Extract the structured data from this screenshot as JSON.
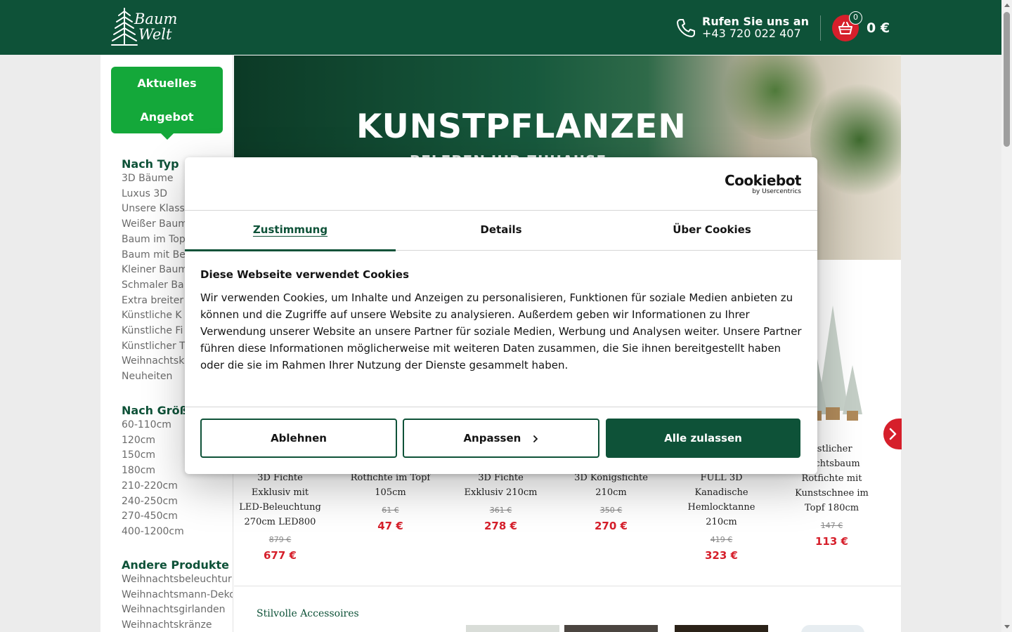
{
  "header": {
    "logo": [
      "Baum",
      "Welt"
    ],
    "phone_label": "Rufen Sie uns an",
    "phone_number": "+43 720 022 407",
    "cart_count": "0",
    "cart_total": "0 €"
  },
  "sidebar": {
    "offer_lines": [
      "Aktuelles",
      "Angebot"
    ],
    "groups": [
      {
        "title": "Nach Typ",
        "items": [
          "3D Bäume",
          "Luxus 3D",
          "Unsere Klass",
          "Weißer Baum",
          "Baum im Top",
          "Baum mit Be",
          "Kleiner Baum",
          "Schmaler Ba",
          "Extra breiter",
          "Künstliche K",
          "Künstliche Fi",
          "Künstlicher T",
          "Weihnachtsk",
          "Neuheiten"
        ]
      },
      {
        "title": "Nach Größ",
        "items": [
          "60-110cm",
          "120cm",
          "150cm",
          "180cm",
          "210-220cm",
          "240-250cm",
          "270-450cm",
          "400-1200cm"
        ]
      },
      {
        "title": "Andere Produkte",
        "items": [
          "Weihnachtsbeleuchtur",
          "Weihnachtsmann-Deko",
          "Weihnachtsgirlanden",
          "Weihnachtskränze"
        ]
      }
    ]
  },
  "banner": {
    "title": "KUNSTPFLANZEN",
    "subtitle": "BELEBEN IHR ZUHAUSE"
  },
  "products": [
    {
      "name": [
        "3D Fichte",
        "Exklusiv mit",
        "LED-Beleuchtung",
        "270cm LED800"
      ],
      "old_price": "879 €",
      "price": "677 €"
    },
    {
      "name": [
        "Rotfichte im Topf",
        "105cm"
      ],
      "old_price": "61 €",
      "price": "47 €"
    },
    {
      "name": [
        "3D Fichte",
        "Exklusiv 210cm"
      ],
      "old_price": "361 €",
      "price": "278 €"
    },
    {
      "name": [
        "3D Königsfichte",
        "210cm"
      ],
      "old_price": "350 €",
      "price": "270 €"
    },
    {
      "name": [
        "FULL 3D",
        "Kanadische",
        "Hemlocktanne",
        "210cm"
      ],
      "old_price": "419 €",
      "price": "323 €"
    },
    {
      "name": [
        "nstlicher",
        "nachtsbaum",
        "Rotfichte mit",
        "Kunstschnee im",
        "Topf 180cm"
      ],
      "old_price": "147 €",
      "price": "113 €"
    }
  ],
  "accessories": {
    "title": "Stilvolle Accessoires "
  },
  "cookie": {
    "logo_main": "Cookiebot",
    "logo_sub": "by Usercentrics",
    "tabs": [
      "Zustimmung",
      "Details",
      "Über Cookies"
    ],
    "heading": "Diese Webseite verwendet Cookies",
    "body": "Wir verwenden Cookies, um Inhalte und Anzeigen zu personalisieren, Funktionen für soziale Medien anbieten zu können und die Zugriffe auf unsere Website zu analysieren. Außerdem geben wir Informationen zu Ihrer Verwendung unserer Website an unsere Partner für soziale Medien, Werbung und Analysen weiter. Unsere Partner führen diese Informationen möglicherweise mit weiteren Daten zusammen, die Sie ihnen bereitgestellt haben oder die sie im Rahmen Ihrer Nutzung der Dienste gesammelt haben.",
    "btn_decline": "Ablehnen",
    "btn_customize": "Anpassen",
    "btn_accept": "Alle zulassen"
  },
  "colors": {
    "brand_green": "#0e5238",
    "offer_green": "#14a83a",
    "price_red": "#d61f2b"
  }
}
